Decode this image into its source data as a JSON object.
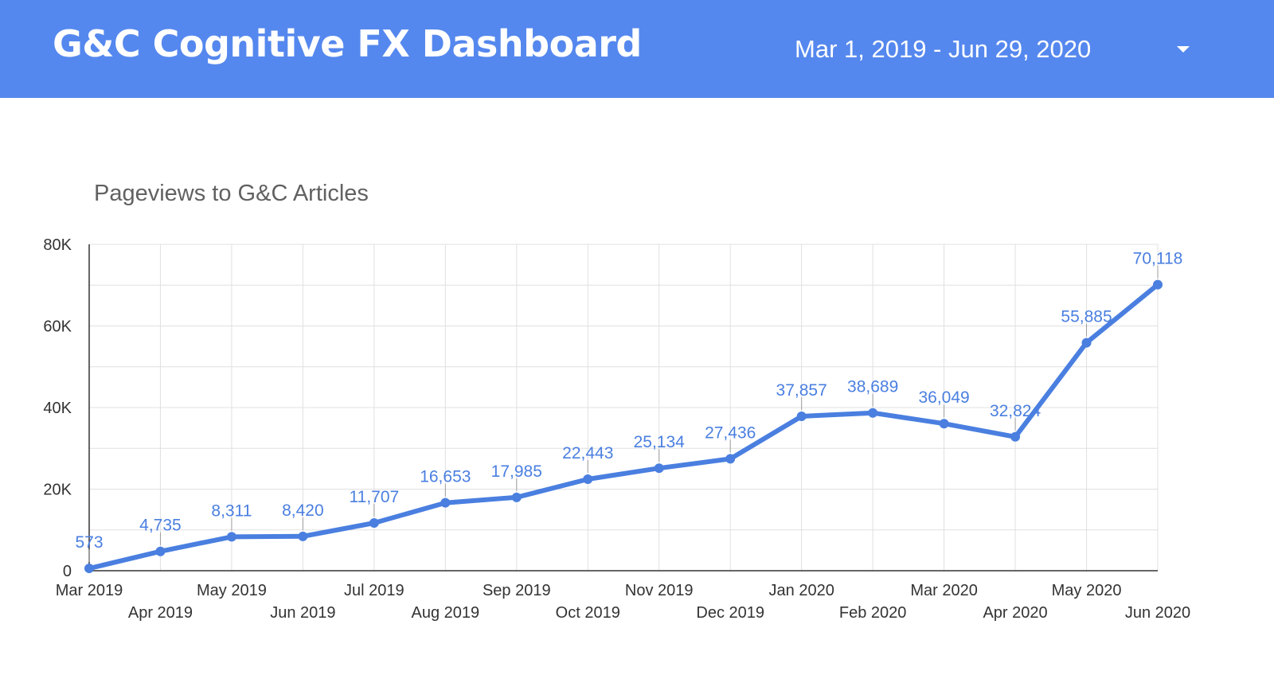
{
  "header": {
    "title": "G&C Cognitive FX Dashboard",
    "date_range": "Mar 1, 2019 - Jun 29, 2020"
  },
  "colors": {
    "header_bg": "#5588ee",
    "series_line": "#4a7fe0",
    "grid": "#e0e0e0"
  },
  "icons": {
    "date_dropdown": "caret-down-icon"
  },
  "chart_data": {
    "type": "line",
    "title": "Pageviews to G&C Articles",
    "xlabel": "",
    "ylabel": "",
    "categories": [
      "Mar 2019",
      "Apr 2019",
      "May 2019",
      "Jun 2019",
      "Jul 2019",
      "Aug 2019",
      "Sep 2019",
      "Oct 2019",
      "Nov 2019",
      "Dec 2019",
      "Jan 2020",
      "Feb 2020",
      "Mar 2020",
      "Apr 2020",
      "May 2020",
      "Jun 2020"
    ],
    "series": [
      {
        "values": [
          573,
          4735,
          8311,
          8420,
          11707,
          16653,
          17985,
          22443,
          25134,
          27436,
          37857,
          38689,
          36049,
          32824,
          55885,
          70118
        ],
        "labels": [
          "573",
          "4,735",
          "8,311",
          "8,420",
          "11,707",
          "16,653",
          "17,985",
          "22,443",
          "25,134",
          "27,436",
          "37,857",
          "38,689",
          "36,049",
          "32,824",
          "55,885",
          "70,118"
        ]
      }
    ],
    "ylim": [
      0,
      80000
    ],
    "yticks": [
      0,
      20000,
      40000,
      60000,
      80000
    ],
    "ytick_labels": [
      "0",
      "20K",
      "40K",
      "60K",
      "80K"
    ],
    "grid": true,
    "legend": "none"
  }
}
